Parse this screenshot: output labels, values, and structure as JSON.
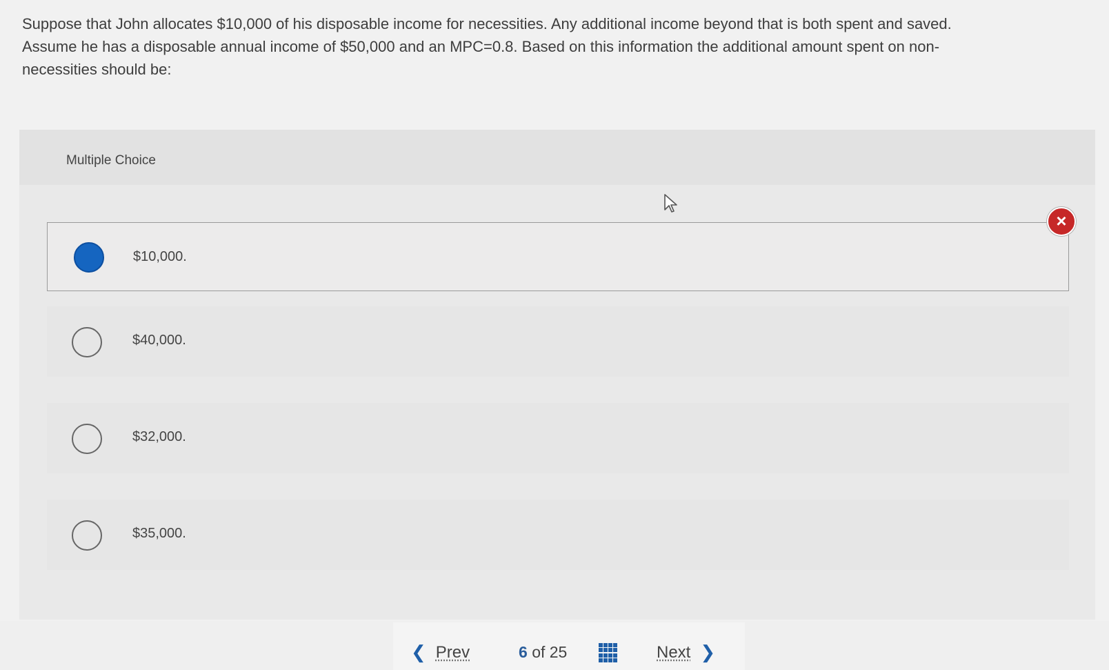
{
  "question": {
    "line1": "Suppose that John allocates $10,000 of his disposable income for necessities. Any additional income beyond that is both spent and saved.",
    "line2": "Assume he has a disposable annual income of $50,000 and an MPC=0.8. Based on this information the additional amount spent on non-",
    "line3": "necessities should be:"
  },
  "multiple_choice": {
    "label": "Multiple Choice",
    "options": [
      {
        "text": "$10,000.",
        "selected": true
      },
      {
        "text": "$40,000.",
        "selected": false
      },
      {
        "text": "$32,000.",
        "selected": false
      },
      {
        "text": "$35,000.",
        "selected": false
      }
    ],
    "result_icon": "incorrect-x-icon",
    "result_color": "#c62828"
  },
  "navigation": {
    "prev_label": "Prev",
    "current": "6",
    "of_label": "of",
    "total": "25",
    "next_label": "Next",
    "grid_icon": "grid-icon"
  },
  "colors": {
    "accent": "#1f5fa8",
    "selected_radio": "#1565c0"
  }
}
